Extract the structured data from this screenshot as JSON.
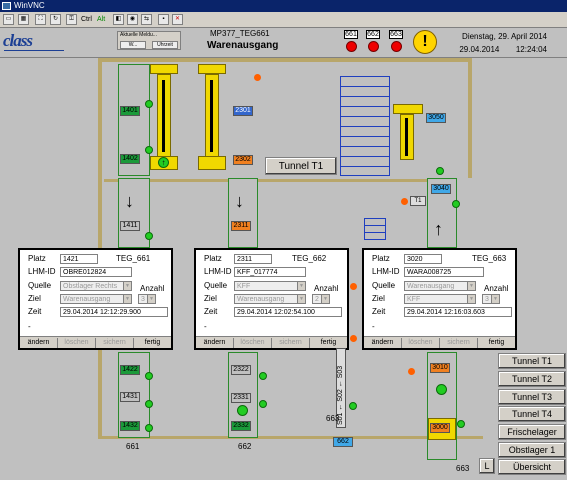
{
  "window": {
    "title": "WinVNC"
  },
  "toolbar": {
    "ctrl_label": "Ctrl",
    "alt_label": "Alt"
  },
  "header": {
    "logo_text": "class",
    "message_box": {
      "title": "Aktuelle Meldu...",
      "btn1": "W...",
      "btn2": "Uhrzeit"
    },
    "station_id": "MP377_TEG661",
    "page_title": "Warenausgang",
    "alarms": [
      {
        "label": "661"
      },
      {
        "label": "662"
      },
      {
        "label": "663"
      }
    ],
    "warning_symbol": "!",
    "date": "Dienstag, 29. April 2014",
    "date_short": "29.04.2014",
    "time": "12:24:04"
  },
  "layout": {
    "tunnel_button": "Tunnel T1",
    "slots": {
      "s1401": "1401",
      "s1402": "1402",
      "s1411": "1411",
      "s2301": "2301",
      "s2302": "2302",
      "s2311": "2311",
      "s3050": "3050",
      "s3040": "3040",
      "s1422": "1422",
      "s1431": "1431",
      "s1432": "1432",
      "s2322": "2322",
      "s2331": "2331",
      "s2332": "2332",
      "s3010": "3010",
      "s3000": "3000",
      "s662": "662"
    },
    "lane_labels": {
      "l661": "661",
      "l662": "662",
      "l663a": "663",
      "l663b": "663"
    },
    "small_labels": {
      "t1": "T1",
      "s01": "S01 ← S02 ← S03"
    }
  },
  "panels": [
    {
      "platz_label": "Platz",
      "platz": "1421",
      "teg": "TEG_661",
      "lhm_label": "LHM-ID",
      "lhm": "OBRE012824",
      "quelle_label": "Quelle",
      "quelle": "Obstlager Rechts",
      "anzahl_label": "Anzahl",
      "ziel_label": "Ziel",
      "ziel": "Warenausgang",
      "anzahl": "3",
      "zeit_label": "Zeit",
      "zeit": "29.04.2014 12:12:29.900",
      "dash": "-",
      "btn_aendern": "ändern",
      "btn_loeschen": "löschen",
      "btn_sichern": "sichern",
      "btn_fertig": "fertig"
    },
    {
      "platz_label": "Platz",
      "platz": "2311",
      "teg": "TEG_662",
      "lhm_label": "LHM-ID",
      "lhm": "KFF_017774",
      "quelle_label": "Quelle",
      "quelle": "KFF",
      "anzahl_label": "Anzahl",
      "ziel_label": "Ziel",
      "ziel": "Warenausgang",
      "anzahl": "2",
      "zeit_label": "Zeit",
      "zeit": "29.04.2014 12:02:54.100",
      "dash": "-",
      "btn_aendern": "ändern",
      "btn_loeschen": "löschen",
      "btn_sichern": "sichern",
      "btn_fertig": "fertig"
    },
    {
      "platz_label": "Platz",
      "platz": "3020",
      "teg": "TEG_663",
      "lhm_label": "LHM-ID",
      "lhm": "WARA008725",
      "quelle_label": "Quelle",
      "quelle": "Warenausgang",
      "anzahl_label": "Anzahl",
      "ziel_label": "Ziel",
      "ziel": "KFF",
      "anzahl": "3",
      "zeit_label": "Zeit",
      "zeit": "29.04.2014 12:16:03.603",
      "dash": "-",
      "btn_aendern": "ändern",
      "btn_loeschen": "löschen",
      "btn_sichern": "sichern",
      "btn_fertig": "fertig"
    }
  ],
  "nav": {
    "tunnel_t1": "Tunnel T1",
    "tunnel_t2": "Tunnel T2",
    "tunnel_t3": "Tunnel T3",
    "tunnel_t4": "Tunnel T4",
    "frischelager": "Frischelager",
    "obstlager": "Obstlager 1",
    "uebersicht": "Übersicht",
    "l_button": "L"
  }
}
